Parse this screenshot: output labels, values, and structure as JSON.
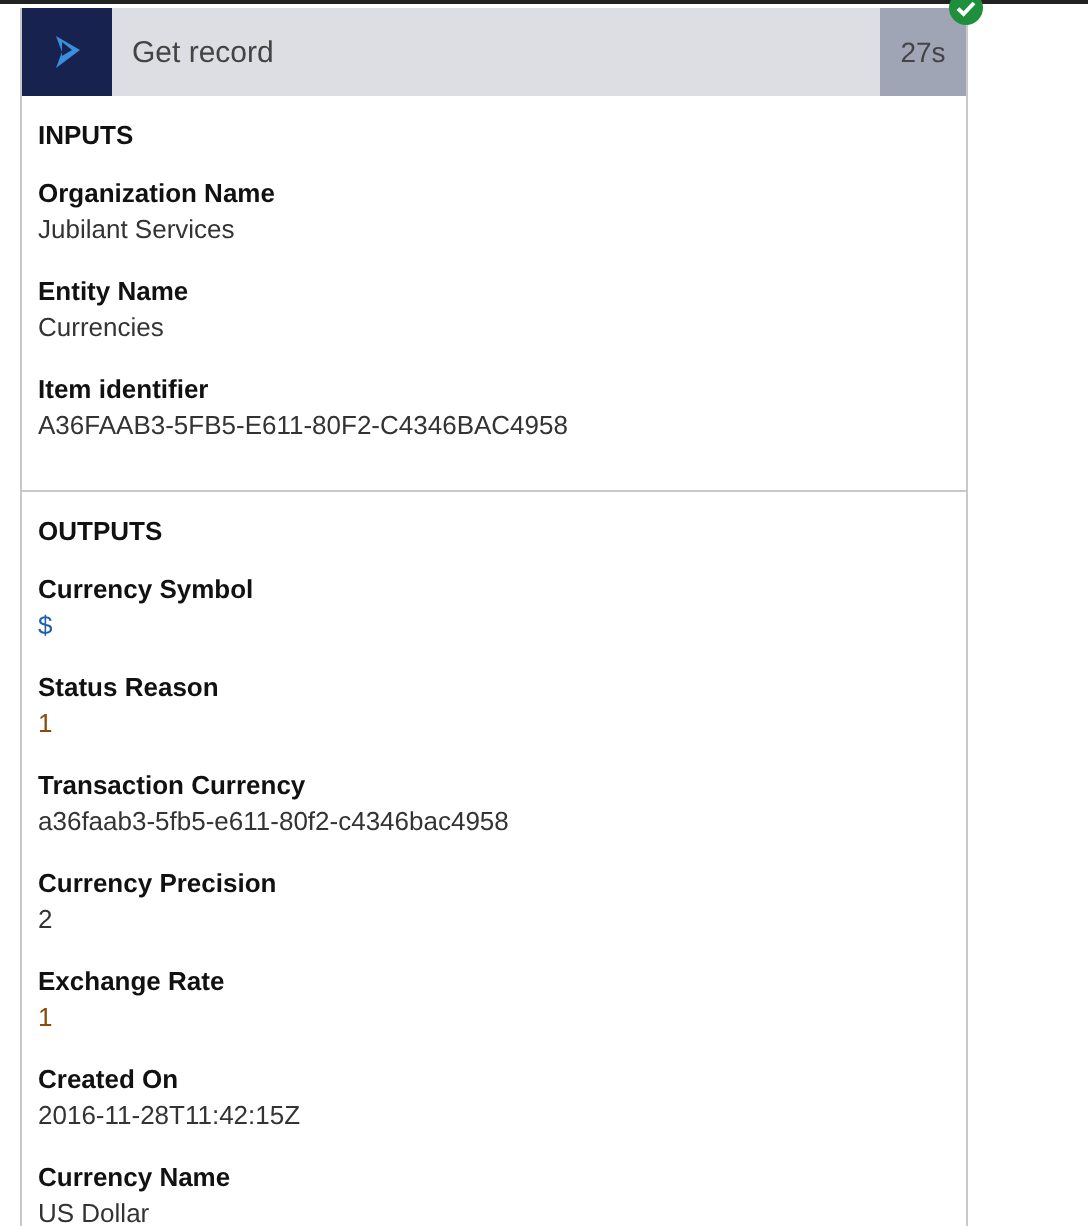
{
  "header": {
    "title": "Get record",
    "duration": "27s",
    "succeeded": true
  },
  "sections": [
    {
      "title": "INPUTS",
      "fields": [
        {
          "label": "Organization Name",
          "value": "Jubilant Services",
          "color": "#333333"
        },
        {
          "label": "Entity Name",
          "value": "Currencies",
          "color": "#333333"
        },
        {
          "label": "Item identifier",
          "value": "A36FAAB3-5FB5-E611-80F2-C4346BAC4958",
          "color": "#333333"
        }
      ]
    },
    {
      "title": "OUTPUTS",
      "fields": [
        {
          "label": "Currency Symbol",
          "value": "$",
          "color": "#1f5fa6"
        },
        {
          "label": "Status Reason",
          "value": "1",
          "color": "#8a4b08"
        },
        {
          "label": "Transaction Currency",
          "value": "a36faab3-5fb5-e611-80f2-c4346bac4958",
          "color": "#333333"
        },
        {
          "label": "Currency Precision",
          "value": "2",
          "color": "#333333"
        },
        {
          "label": "Exchange Rate",
          "value": "1",
          "color": "#8a4b08"
        },
        {
          "label": "Created On",
          "value": "2016-11-28T11:42:15Z",
          "color": "#333333"
        },
        {
          "label": "Currency Name",
          "value": "US Dollar",
          "color": "#333333"
        }
      ]
    }
  ]
}
